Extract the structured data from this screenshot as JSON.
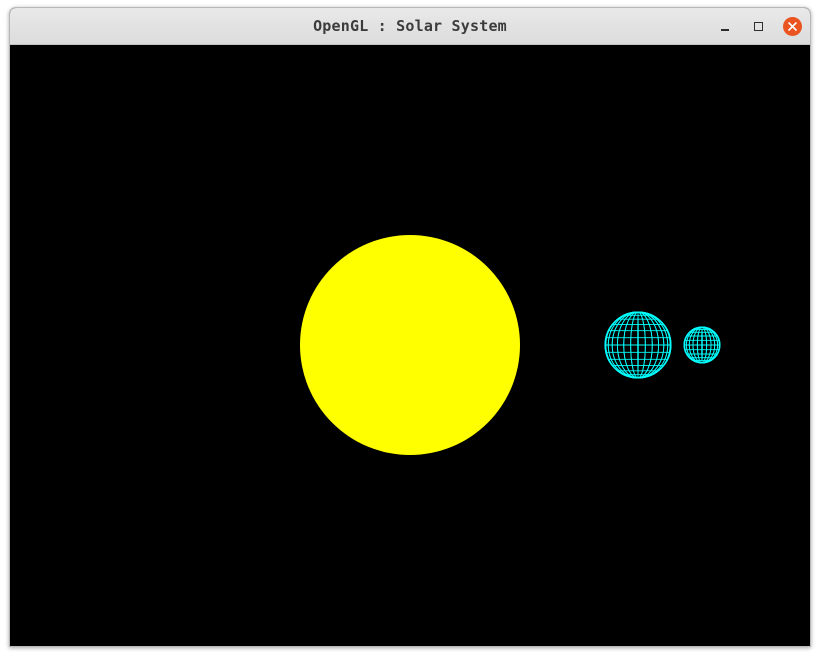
{
  "window": {
    "title": "OpenGL : Solar System"
  },
  "controls": {
    "minimize": "minimize-icon",
    "maximize": "maximize-icon",
    "close": "close-icon"
  },
  "scene": {
    "background": "#000000",
    "sun_color": "#ffff00",
    "planet_color": "#00ffff",
    "close_color": "#e95420"
  }
}
